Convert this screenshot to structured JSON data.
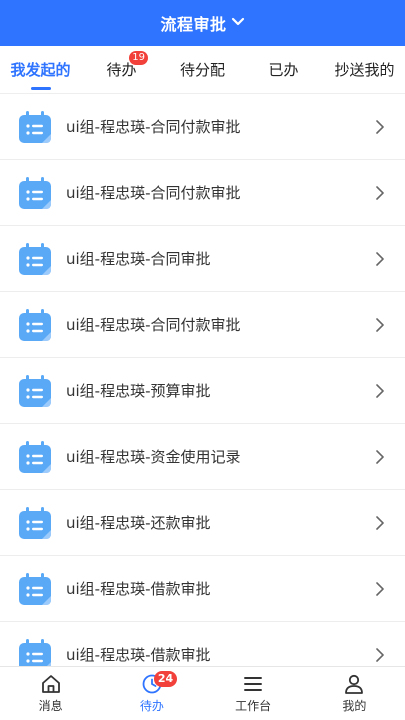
{
  "header": {
    "title": "流程审批"
  },
  "tabs": [
    {
      "label": "我发起的",
      "active": true
    },
    {
      "label": "待办",
      "badge": "19"
    },
    {
      "label": "待分配"
    },
    {
      "label": "已办"
    },
    {
      "label": "抄送我的"
    }
  ],
  "list": {
    "items": [
      {
        "title": "ui组-程忠瑛-合同付款审批"
      },
      {
        "title": "ui组-程忠瑛-合同付款审批"
      },
      {
        "title": "ui组-程忠瑛-合同审批"
      },
      {
        "title": "ui组-程忠瑛-合同付款审批"
      },
      {
        "title": "ui组-程忠瑛-预算审批"
      },
      {
        "title": "ui组-程忠瑛-资金使用记录"
      },
      {
        "title": "ui组-程忠瑛-还款审批"
      },
      {
        "title": "ui组-程忠瑛-借款审批"
      },
      {
        "title": "ui组-程忠瑛-借款审批"
      }
    ]
  },
  "bottom_nav": [
    {
      "label": "消息",
      "icon": "home-icon"
    },
    {
      "label": "待办",
      "icon": "clock-icon",
      "badge": "24",
      "active": true
    },
    {
      "label": "工作台",
      "icon": "menu-icon"
    },
    {
      "label": "我的",
      "icon": "user-icon"
    }
  ],
  "colors": {
    "primary": "#2f74ff",
    "badge": "#f2403a",
    "icon_blue": "#5aa9f7"
  }
}
